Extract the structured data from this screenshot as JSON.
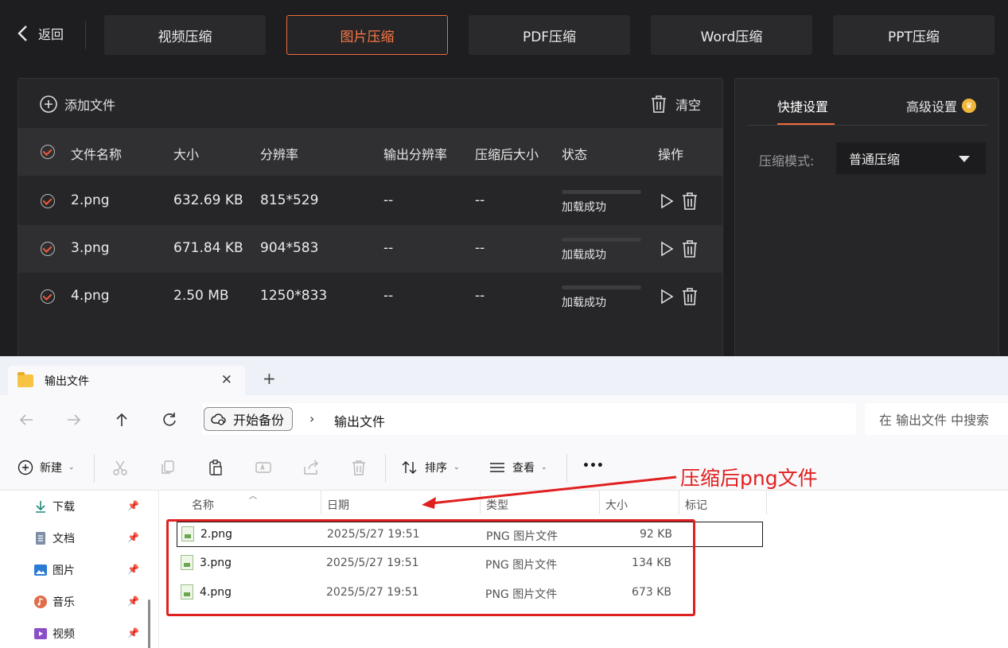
{
  "app": {
    "back_label": "返回",
    "tabs": [
      "视频压缩",
      "图片压缩",
      "PDF压缩",
      "Word压缩",
      "PPT压缩"
    ],
    "active_tab": "图片压缩",
    "add_file_label": "添加文件",
    "clear_label": "清空",
    "columns": [
      "文件名称",
      "大小",
      "分辨率",
      "输出分辨率",
      "压缩后大小",
      "状态",
      "操作"
    ],
    "files": [
      {
        "name": "2.png",
        "size": "632.69 KB",
        "resolution": "815*529",
        "output_resolution": "--",
        "compressed_size": "--",
        "status": "加载成功"
      },
      {
        "name": "3.png",
        "size": "671.84 KB",
        "resolution": "904*583",
        "output_resolution": "--",
        "compressed_size": "--",
        "status": "加载成功"
      },
      {
        "name": "4.png",
        "size": "2.50 MB",
        "resolution": "1250*833",
        "output_resolution": "--",
        "compressed_size": "--",
        "status": "加载成功"
      }
    ],
    "settings": {
      "tabs": [
        "快捷设置",
        "高级设置"
      ],
      "mode_label": "压缩模式:",
      "mode_value": "普通压缩"
    },
    "accent_color": "#ef6b3c"
  },
  "explorer": {
    "tab_title": "输出文件",
    "breadcrumb_root": "开始备份",
    "breadcrumb_current": "输出文件",
    "search_placeholder": "在 输出文件 中搜索",
    "toolbar": {
      "new": "新建",
      "sort": "排序",
      "view": "查看",
      "more": "•••"
    },
    "sidebar": [
      "下载",
      "文档",
      "图片",
      "音乐",
      "视频"
    ],
    "columns": [
      "名称",
      "日期",
      "类型",
      "大小",
      "标记"
    ],
    "files": [
      {
        "name": "2.png",
        "date": "2025/5/27 19:51",
        "type": "PNG 图片文件",
        "size": "92 KB"
      },
      {
        "name": "3.png",
        "date": "2025/5/27 19:51",
        "type": "PNG 图片文件",
        "size": "134 KB"
      },
      {
        "name": "4.png",
        "date": "2025/5/27 19:51",
        "type": "PNG 图片文件",
        "size": "673 KB"
      }
    ]
  },
  "annotation": {
    "text": "压缩后png文件",
    "color": "#e02020"
  }
}
